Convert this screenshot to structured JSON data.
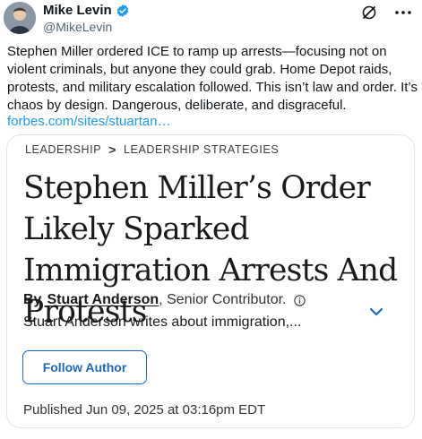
{
  "author": {
    "display_name": "Mike Levin",
    "handle": "@MikeLevin"
  },
  "icons": {
    "verified": "verified-badge-icon",
    "grok": "grok-icon",
    "more": "more-options-icon",
    "info": "info-icon",
    "expand": "chevron-down-icon"
  },
  "colors": {
    "verified": "#1d9bf0",
    "link": "#1d9bf0",
    "follow_button": "#1a69c4"
  },
  "tweet": {
    "text": "Stephen Miller ordered ICE to ramp up arrests—focusing not on violent criminals, but anyone they could grab. Home Depot raids, protests, and military escalation followed. This isn’t law and order. It’s chaos by design. Dangerous, deliberate, and disgraceful.",
    "link_text": "forbes.com/sites/stuartan…"
  },
  "card": {
    "breadcrumb": [
      "LEADERSHIP",
      "LEADERSHIP STRATEGIES"
    ],
    "breadcrumb_separator": ">",
    "headline": "Stephen Miller’s Order Likely Sparked Immigration Arrests And Protests",
    "by_label": "By",
    "author_name": "Stuart Anderson",
    "author_role": ", Senior Contributor.",
    "author_bio": "Stuart Anderson writes about immigration,...",
    "follow_label": "Follow Author",
    "published": "Published Jun 09, 2025 at 03:16pm EDT"
  }
}
